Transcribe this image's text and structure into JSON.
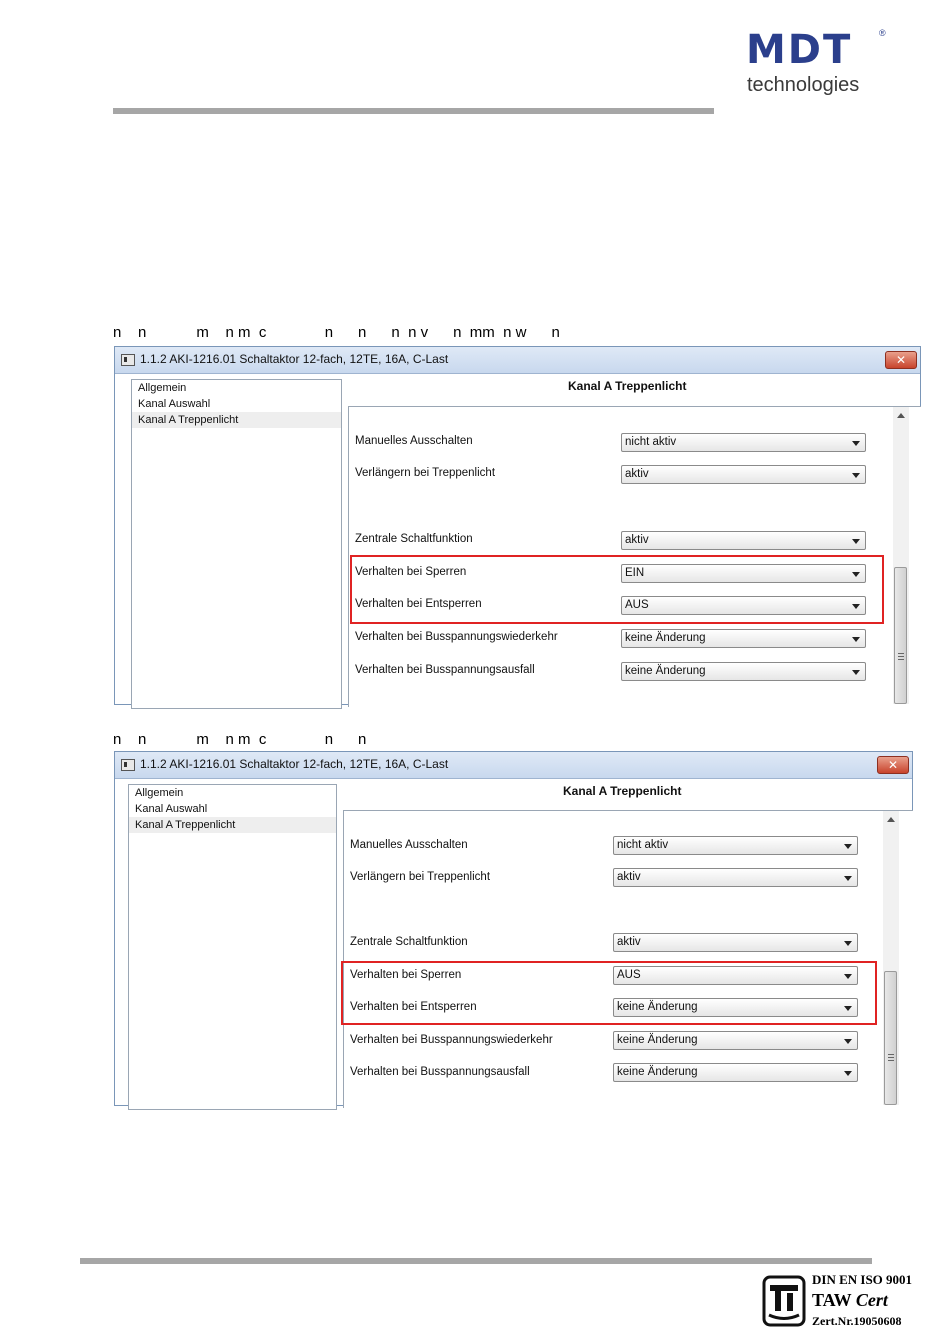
{
  "header": {
    "logo_mark": "MDT",
    "logo_reg": "®",
    "logo_sub": "technologies"
  },
  "captions": [
    "n    n            m    n m  c              n      n      n  n v      n  mm  n w      n",
    "n    n            m    n m  c              n      n"
  ],
  "windows": [
    {
      "title": "1.1.2 AKI-1216.01 Schaltaktor 12-fach, 12TE, 16A, C-Last",
      "close_label": "✕",
      "tree": [
        "Allgemein",
        "Kanal Auswahl",
        "Kanal A Treppenlicht"
      ],
      "selected_index": 2,
      "panel_title": "Kanal A Treppenlicht",
      "rows": [
        {
          "label": "Manuelles Ausschalten",
          "value": "nicht aktiv"
        },
        {
          "label": "Verlängern bei Treppenlicht",
          "value": "aktiv"
        },
        {
          "label": "Zentrale Schaltfunktion",
          "value": "aktiv"
        },
        {
          "label": "Verhalten bei Sperren",
          "value": "EIN"
        },
        {
          "label": "Verhalten bei Entsperren",
          "value": "AUS"
        },
        {
          "label": "Verhalten bei Busspannungswiederkehr",
          "value": "keine Änderung"
        },
        {
          "label": "Verhalten bei Busspannungsausfall",
          "value": "keine Änderung"
        }
      ]
    },
    {
      "title": "1.1.2 AKI-1216.01 Schaltaktor 12-fach, 12TE, 16A, C-Last",
      "close_label": "✕",
      "tree": [
        "Allgemein",
        "Kanal Auswahl",
        "Kanal A Treppenlicht"
      ],
      "selected_index": 2,
      "panel_title": "Kanal A Treppenlicht",
      "rows": [
        {
          "label": "Manuelles Ausschalten",
          "value": "nicht aktiv"
        },
        {
          "label": "Verlängern bei Treppenlicht",
          "value": "aktiv"
        },
        {
          "label": "Zentrale Schaltfunktion",
          "value": "aktiv"
        },
        {
          "label": "Verhalten bei Sperren",
          "value": "AUS"
        },
        {
          "label": "Verhalten bei Entsperren",
          "value": "keine Änderung"
        },
        {
          "label": "Verhalten bei Busspannungswiederkehr",
          "value": "keine Änderung"
        },
        {
          "label": "Verhalten bei Busspannungsausfall",
          "value": "keine Änderung"
        }
      ]
    }
  ],
  "certification": {
    "line1": "DIN EN ISO 9001",
    "line2a": "TAW ",
    "line2b": "Cert",
    "line3": "Zert.Nr.19050608"
  },
  "colors": {
    "brand": "#2b3f8c",
    "highlight": "#e02323",
    "rule": "#a6a6a6"
  }
}
